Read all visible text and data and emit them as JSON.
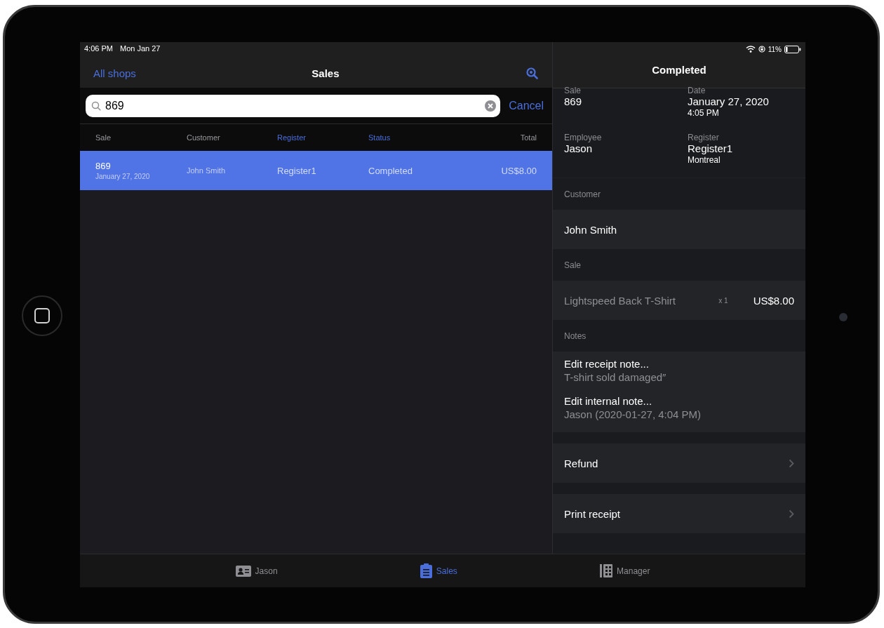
{
  "status_bar": {
    "time": "4:06 PM",
    "date": "Mon Jan 27",
    "battery": "11%"
  },
  "sales_pane": {
    "back": "All shops",
    "title": "Sales",
    "search": {
      "value": "869"
    },
    "cancel": "Cancel",
    "columns": [
      {
        "label": "Sale",
        "active": false
      },
      {
        "label": "Customer",
        "active": false
      },
      {
        "label": "Register",
        "active": true
      },
      {
        "label": "Status",
        "active": true
      },
      {
        "label": "Total",
        "active": false
      }
    ],
    "rows": [
      {
        "sale": "869",
        "date": "January 27, 2020",
        "customer": "John Smith",
        "register": "Register1",
        "status": "Completed",
        "total": "US$8.00",
        "selected": true
      }
    ]
  },
  "detail_pane": {
    "title": "Completed",
    "fields": [
      {
        "label": "Sale",
        "value": "869"
      },
      {
        "label": "Date",
        "value": "January 27, 2020",
        "sub": "4:05 PM"
      },
      {
        "label": "Employee",
        "value": "Jason"
      },
      {
        "label": "Register",
        "value": "Register1",
        "sub": "Montreal"
      }
    ],
    "customer": {
      "heading": "Customer",
      "name": "John Smith"
    },
    "sale": {
      "heading": "Sale",
      "items": [
        {
          "name": "Lightspeed Back T-Shirt",
          "qty": "x 1",
          "price": "US$8.00"
        }
      ]
    },
    "notes": {
      "heading": "Notes",
      "items": [
        {
          "title": "Edit receipt note...",
          "text": "T-shirt sold damaged″"
        },
        {
          "title": "Edit internal note...",
          "text": "Jason (2020-01-27, 4:04 PM)"
        }
      ]
    },
    "actions": [
      {
        "label": "Refund"
      },
      {
        "label": "Print receipt"
      }
    ]
  },
  "tab_bar": [
    {
      "label": "Jason",
      "kind": "contact",
      "selected": false
    },
    {
      "label": "Sales",
      "kind": "clipboard",
      "selected": true
    },
    {
      "label": "Manager",
      "kind": "building",
      "selected": false
    }
  ]
}
